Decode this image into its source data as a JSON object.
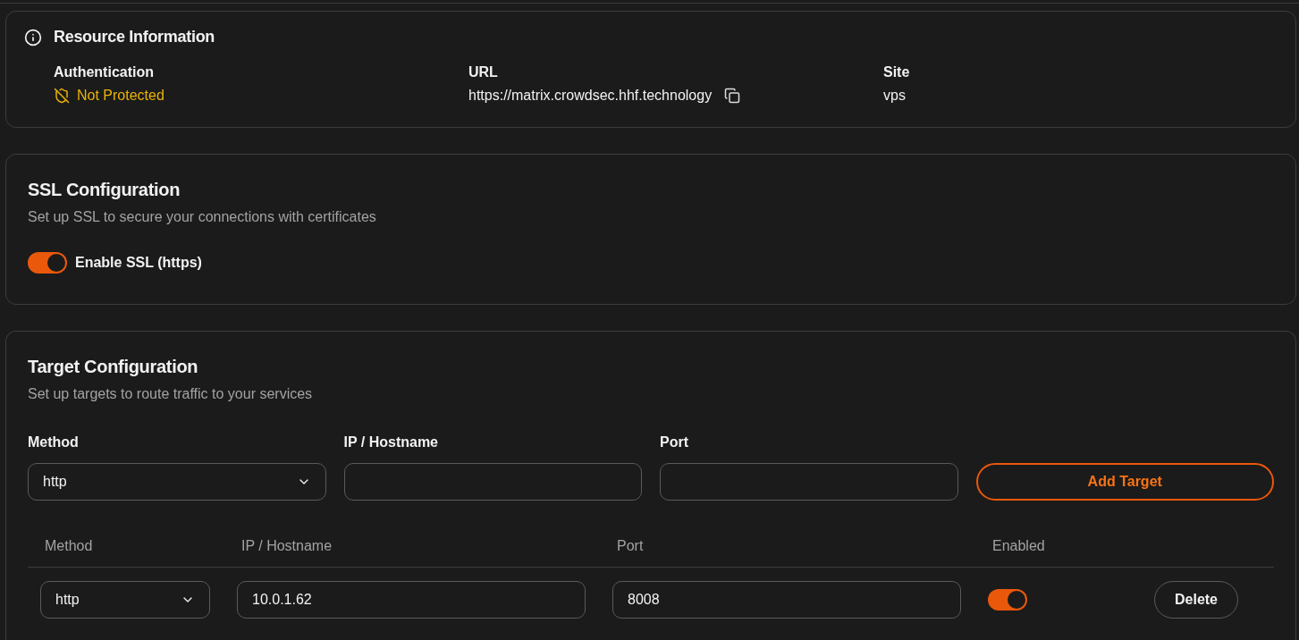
{
  "resource_info": {
    "title": "Resource Information",
    "authentication": {
      "label": "Authentication",
      "value": "Not Protected",
      "protected": false
    },
    "url": {
      "label": "URL",
      "value": "https://matrix.crowdsec.hhf.technology"
    },
    "site": {
      "label": "Site",
      "value": "vps"
    }
  },
  "ssl": {
    "title": "SSL Configuration",
    "description": "Set up SSL to secure your connections with certificates",
    "toggle": {
      "label": "Enable SSL (https)",
      "on": true
    }
  },
  "targets": {
    "title": "Target Configuration",
    "description": "Set up targets to route traffic to your services",
    "form": {
      "method_label": "Method",
      "method_value": "http",
      "host_label": "IP / Hostname",
      "port_label": "Port",
      "add_button": "Add Target"
    },
    "table": {
      "columns": [
        "Method",
        "IP / Hostname",
        "Port",
        "Enabled"
      ],
      "rows": [
        {
          "method": "http",
          "host": "10.0.1.62",
          "port": "8008",
          "enabled": true,
          "delete": "Delete"
        }
      ]
    }
  }
}
